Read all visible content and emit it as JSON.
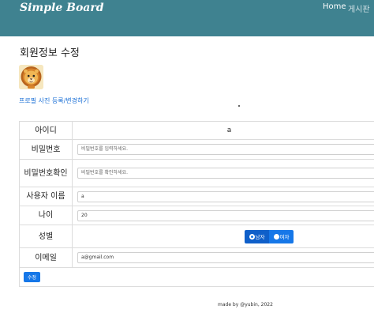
{
  "navbar": {
    "brand": "Simple Board",
    "home": "Home",
    "board": "게시판",
    "color": "#3f8290"
  },
  "page": {
    "title": "회원정보 수정",
    "profile_link": "프로필 사진 등록/변경하기"
  },
  "form": {
    "id_label": "아이디",
    "id_value": "a",
    "password_label": "비밀번호",
    "password_placeholder": "비밀번호를 입력하세요.",
    "password_confirm_label": "비밀번호확인",
    "password_confirm_placeholder": "비밀번호를 확인하세요.",
    "name_label": "사용자 이름",
    "name_value": "a",
    "age_label": "나이",
    "age_value": "20",
    "gender_label": "성별",
    "gender_options": [
      "남자",
      "여자"
    ],
    "gender_selected": "남자",
    "email_label": "이메일",
    "email_value": "a@gmail.com",
    "submit_label": "수정"
  },
  "footer": {
    "text": "made by @yubin, 2022"
  }
}
